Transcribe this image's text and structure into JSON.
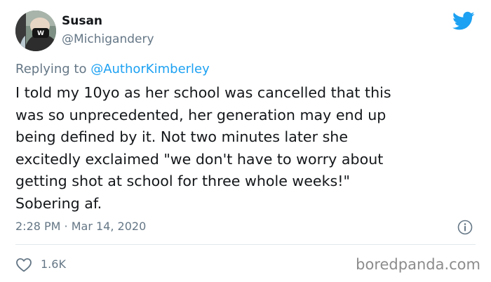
{
  "author": {
    "name": "Susan",
    "handle": "@Michigandery"
  },
  "reply": {
    "prefix": "Replying to ",
    "mention": "@AuthorKimberley"
  },
  "tweet": {
    "text": "I told my 10yo as her school was cancelled that this\nwas so unprecedented, her generation may end up\nbeing defined by it. Not two minutes later she\nexcitedly exclaimed \"we don't have to worry about\ngetting shot at school for three whole weeks!\"\nSobering af.",
    "timestamp": "2:28 PM · Mar 14, 2020"
  },
  "stats": {
    "likes": "1.6K"
  },
  "watermark": "boredpanda.com",
  "colors": {
    "brand": "#1da1f2",
    "muted": "#657786",
    "text": "#14171a"
  },
  "icons": {
    "logo": "twitter-bird-icon",
    "info": "info-icon",
    "like": "heart-icon"
  }
}
